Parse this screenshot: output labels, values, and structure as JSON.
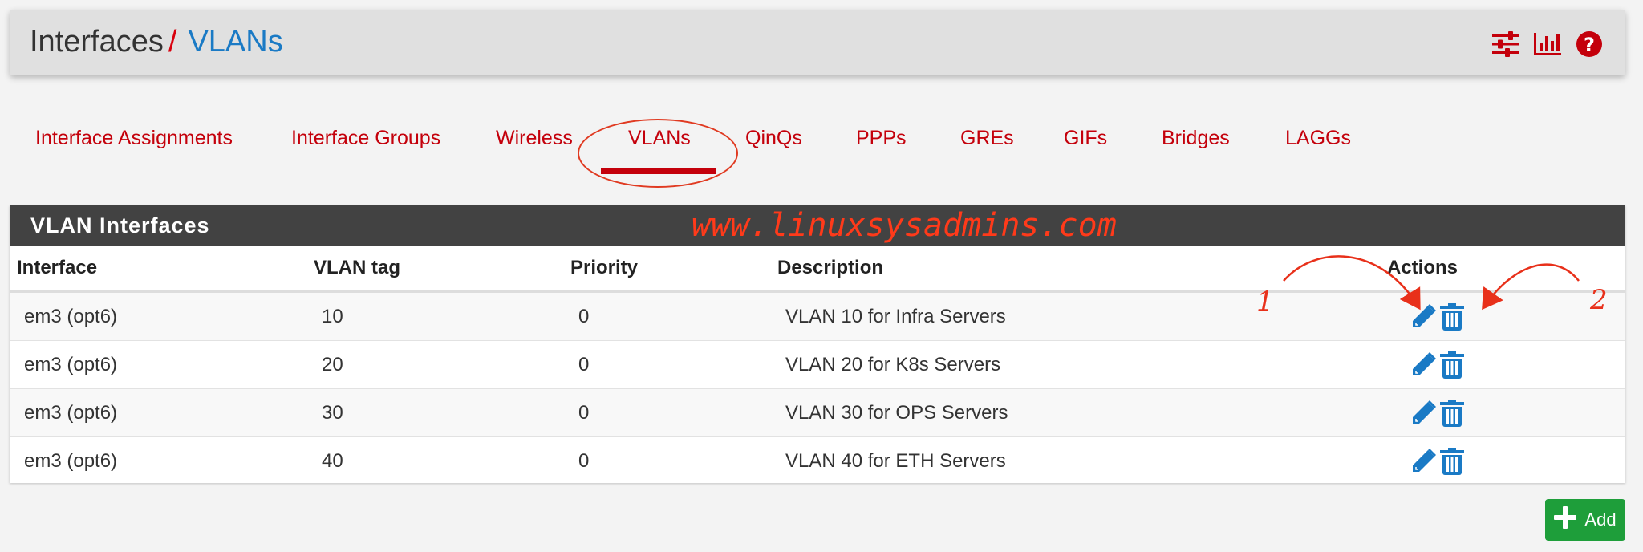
{
  "header": {
    "breadcrumb_parent": "Interfaces",
    "breadcrumb_separator": "/",
    "breadcrumb_current": "VLANs",
    "icons": [
      "sliders-icon",
      "bar-chart-icon",
      "help-icon"
    ]
  },
  "tabs": [
    {
      "label": "Interface Assignments",
      "active": false
    },
    {
      "label": "Interface Groups",
      "active": false
    },
    {
      "label": "Wireless",
      "active": false
    },
    {
      "label": "VLANs",
      "active": true
    },
    {
      "label": "QinQs",
      "active": false
    },
    {
      "label": "PPPs",
      "active": false
    },
    {
      "label": "GREs",
      "active": false
    },
    {
      "label": "GIFs",
      "active": false
    },
    {
      "label": "Bridges",
      "active": false
    },
    {
      "label": "LAGGs",
      "active": false
    }
  ],
  "panel": {
    "title": "VLAN Interfaces",
    "watermark": "www.linuxsysadmins.com"
  },
  "table": {
    "headers": [
      "Interface",
      "VLAN tag",
      "Priority",
      "Description",
      "Actions"
    ],
    "rows": [
      {
        "interface": "em3 (opt6)",
        "tag": "10",
        "priority": "0",
        "description": "VLAN 10 for Infra Servers"
      },
      {
        "interface": "em3 (opt6)",
        "tag": "20",
        "priority": "0",
        "description": "VLAN 20 for K8s Servers"
      },
      {
        "interface": "em3 (opt6)",
        "tag": "30",
        "priority": "0",
        "description": "VLAN 30 for OPS Servers"
      },
      {
        "interface": "em3 (opt6)",
        "tag": "40",
        "priority": "0",
        "description": "VLAN 40 for ETH Servers"
      }
    ],
    "row_action_icons": [
      "pencil-icon",
      "trash-icon"
    ]
  },
  "annotations": {
    "label_1": "1",
    "label_2": "2"
  },
  "add_button": {
    "label": "Add",
    "icon": "plus-icon"
  },
  "colors": {
    "accent_red": "#c4000b",
    "link_blue": "#1a7ac5",
    "add_green": "#1e9e3a",
    "annotation_red": "#e8301a"
  }
}
